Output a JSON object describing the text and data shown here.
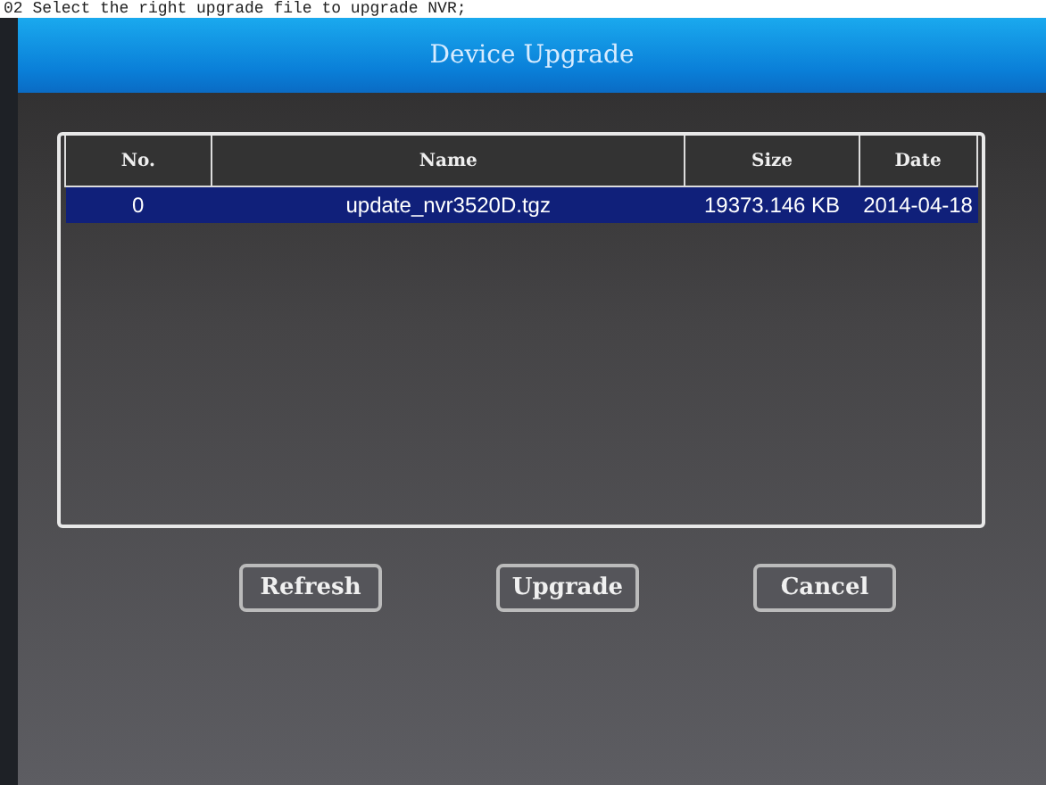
{
  "caption": "02 Select the right upgrade file to upgrade NVR;",
  "window": {
    "title": "Device Upgrade"
  },
  "table": {
    "columns": [
      "No.",
      "Name",
      "Size",
      "Date"
    ],
    "rows": [
      {
        "cells": [
          "0",
          "update_nvr3520D.tgz",
          "19373.146 KB",
          "2014-04-18"
        ],
        "selected": true
      }
    ]
  },
  "buttons": [
    "Refresh",
    "Upgrade",
    "Cancel"
  ]
}
